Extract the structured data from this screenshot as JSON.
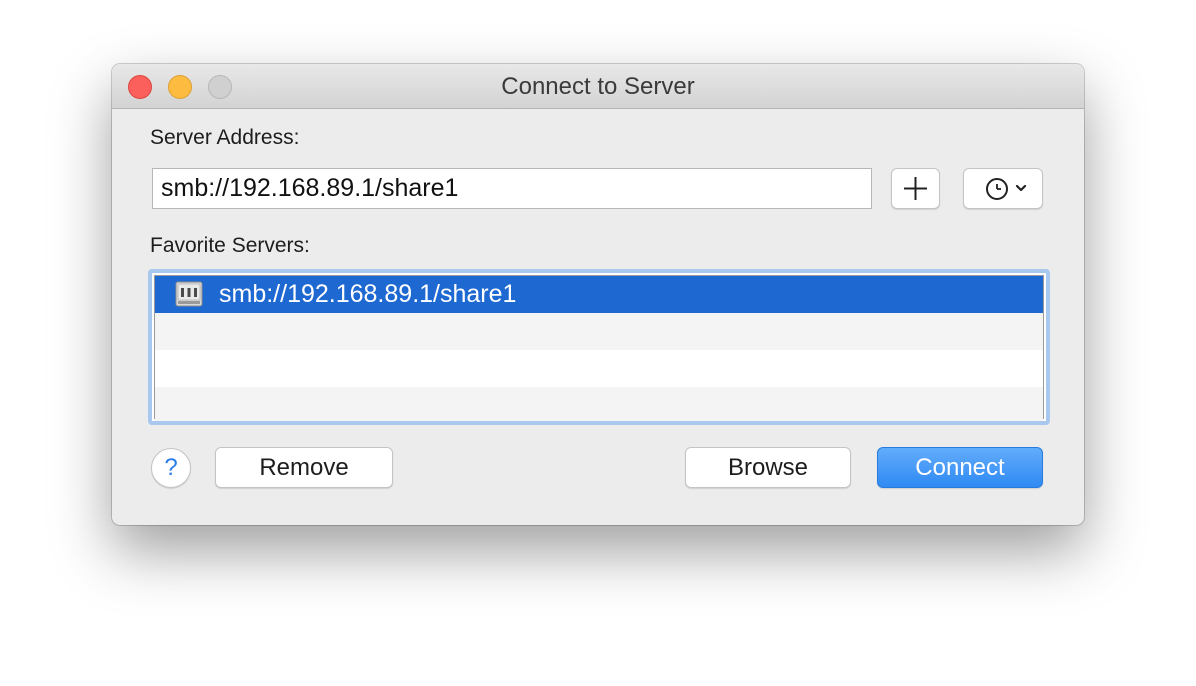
{
  "window": {
    "title": "Connect to Server"
  },
  "server_address": {
    "label": "Server Address:",
    "value": "smb://192.168.89.1/share1",
    "add_icon": "plus-icon",
    "history_icon": "clock-icon",
    "history_chevron": "chevron-down-icon"
  },
  "favorites": {
    "label": "Favorite Servers:",
    "items": [
      {
        "label": "smb://192.168.89.1/share1",
        "icon": "network-server-icon",
        "selected": true
      }
    ]
  },
  "buttons": {
    "help_label": "?",
    "remove_label": "Remove",
    "browse_label": "Browse",
    "connect_label": "Connect"
  },
  "colors": {
    "selection": "#1e68d2",
    "accent": "#2f8af3",
    "close": "#fc605c",
    "minimize": "#fdbc40",
    "zoom_disabled": "#d0d0d0"
  }
}
